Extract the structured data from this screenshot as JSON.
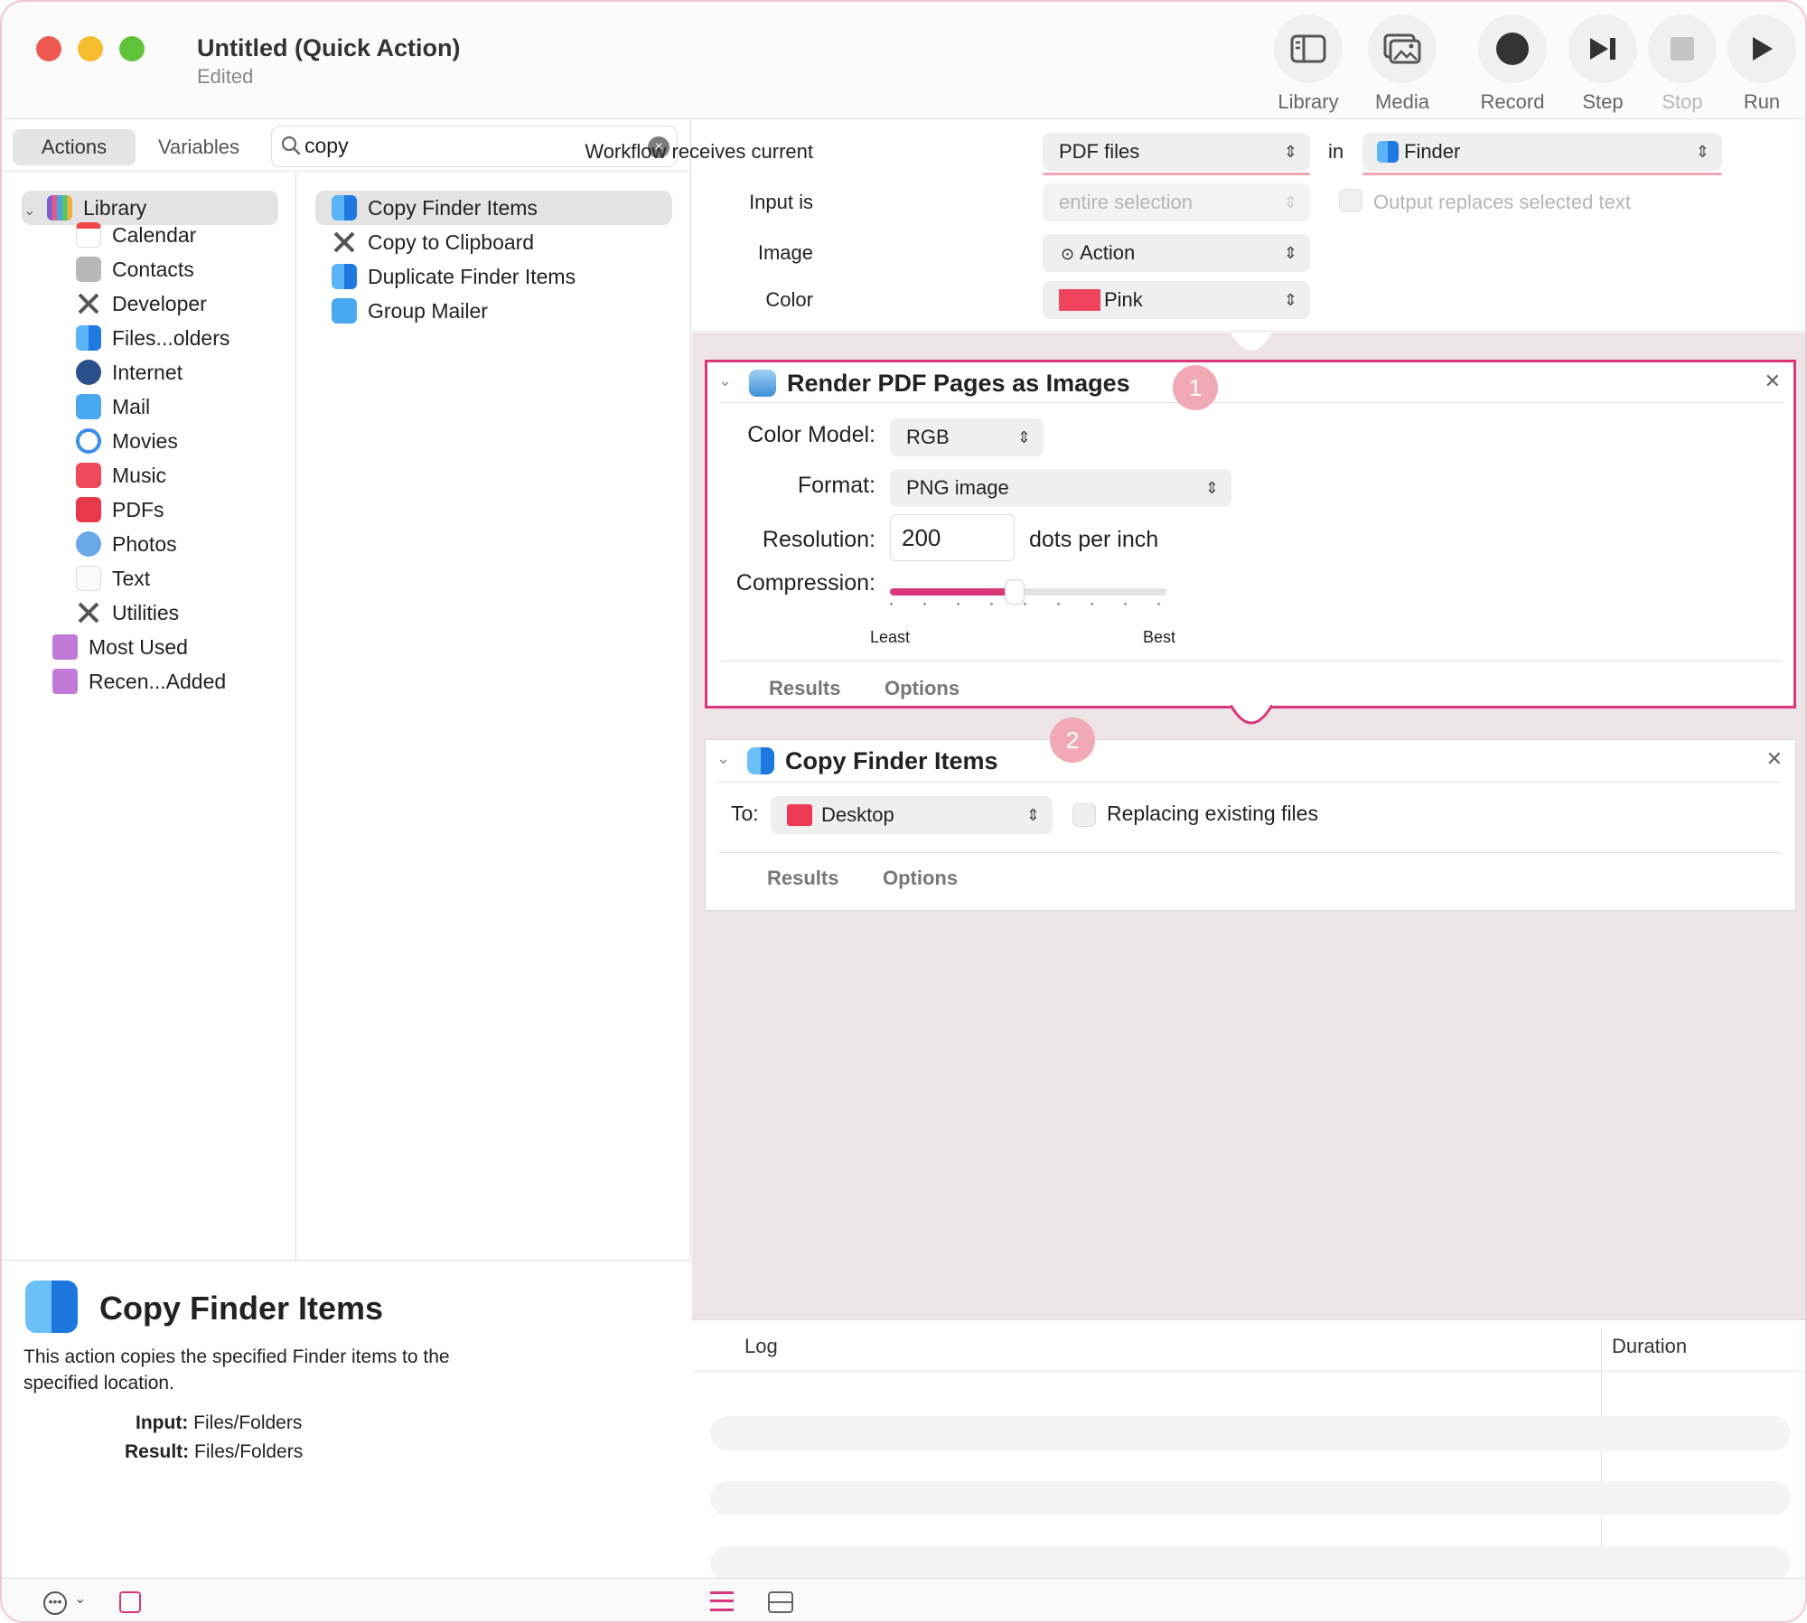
{
  "window": {
    "title": "Untitled (Quick Action)",
    "subtitle": "Edited"
  },
  "toolbar": {
    "library": "Library",
    "media": "Media",
    "record": "Record",
    "step": "Step",
    "stop": "Stop",
    "run": "Run"
  },
  "left": {
    "tabs": [
      "Actions",
      "Variables"
    ],
    "search_value": "copy",
    "library": [
      {
        "label": "Library",
        "icon": "library-icon"
      },
      {
        "label": "Calendar",
        "icon": "calendar-icon"
      },
      {
        "label": "Contacts",
        "icon": "contacts-icon"
      },
      {
        "label": "Developer",
        "icon": "developer-icon"
      },
      {
        "label": "Files...olders",
        "icon": "finder-icon"
      },
      {
        "label": "Internet",
        "icon": "internet-icon"
      },
      {
        "label": "Mail",
        "icon": "mail-icon"
      },
      {
        "label": "Movies",
        "icon": "movies-icon"
      },
      {
        "label": "Music",
        "icon": "music-icon"
      },
      {
        "label": "PDFs",
        "icon": "pdf-icon"
      },
      {
        "label": "Photos",
        "icon": "photos-icon"
      },
      {
        "label": "Text",
        "icon": "text-icon"
      },
      {
        "label": "Utilities",
        "icon": "utilities-icon"
      },
      {
        "label": "Most Used",
        "icon": "smart-folder-icon"
      },
      {
        "label": "Recen...Added",
        "icon": "smart-folder-icon"
      }
    ],
    "actions": [
      {
        "label": "Copy Finder Items",
        "icon": "finder-icon"
      },
      {
        "label": "Copy to Clipboard",
        "icon": "utilities-icon"
      },
      {
        "label": "Duplicate Finder Items",
        "icon": "finder-icon"
      },
      {
        "label": "Group Mailer",
        "icon": "mail-icon"
      }
    ],
    "description": {
      "title": "Copy Finder Items",
      "text": "This action copies the specified Finder items to the specified location.",
      "input_label": "Input:",
      "input_value": "Files/Folders",
      "result_label": "Result:",
      "result_value": "Files/Folders"
    }
  },
  "workflow": {
    "receives_label": "Workflow receives current",
    "receives_value": "PDF files",
    "in_label": "in",
    "in_value": "Finder",
    "input_is_label": "Input is",
    "input_is_value": "entire selection",
    "output_replaces_label": "Output replaces selected text",
    "image_label": "Image",
    "image_value": "Action",
    "color_label": "Color",
    "color_value": "Pink",
    "color_swatch": "#f0445d"
  },
  "actions": [
    {
      "number": "1",
      "title": "Render PDF Pages as Images",
      "color_model_label": "Color Model:",
      "color_model_value": "RGB",
      "format_label": "Format:",
      "format_value": "PNG image",
      "resolution_label": "Resolution:",
      "resolution_value": "200",
      "resolution_unit": "dots per inch",
      "compression_label": "Compression:",
      "compression_level": 0.45,
      "slider_min_label": "Least",
      "slider_max_label": "Best",
      "tab_results": "Results",
      "tab_options": "Options"
    },
    {
      "number": "2",
      "title": "Copy Finder Items",
      "to_label": "To:",
      "to_value": "Desktop",
      "replacing_label": "Replacing existing files",
      "tab_results": "Results",
      "tab_options": "Options"
    }
  ],
  "log": {
    "log_header": "Log",
    "duration_header": "Duration"
  },
  "colors": {
    "accent": "#d9377a",
    "highlight_underline": "#f0a4b8",
    "canvas": "#ece4e6"
  }
}
